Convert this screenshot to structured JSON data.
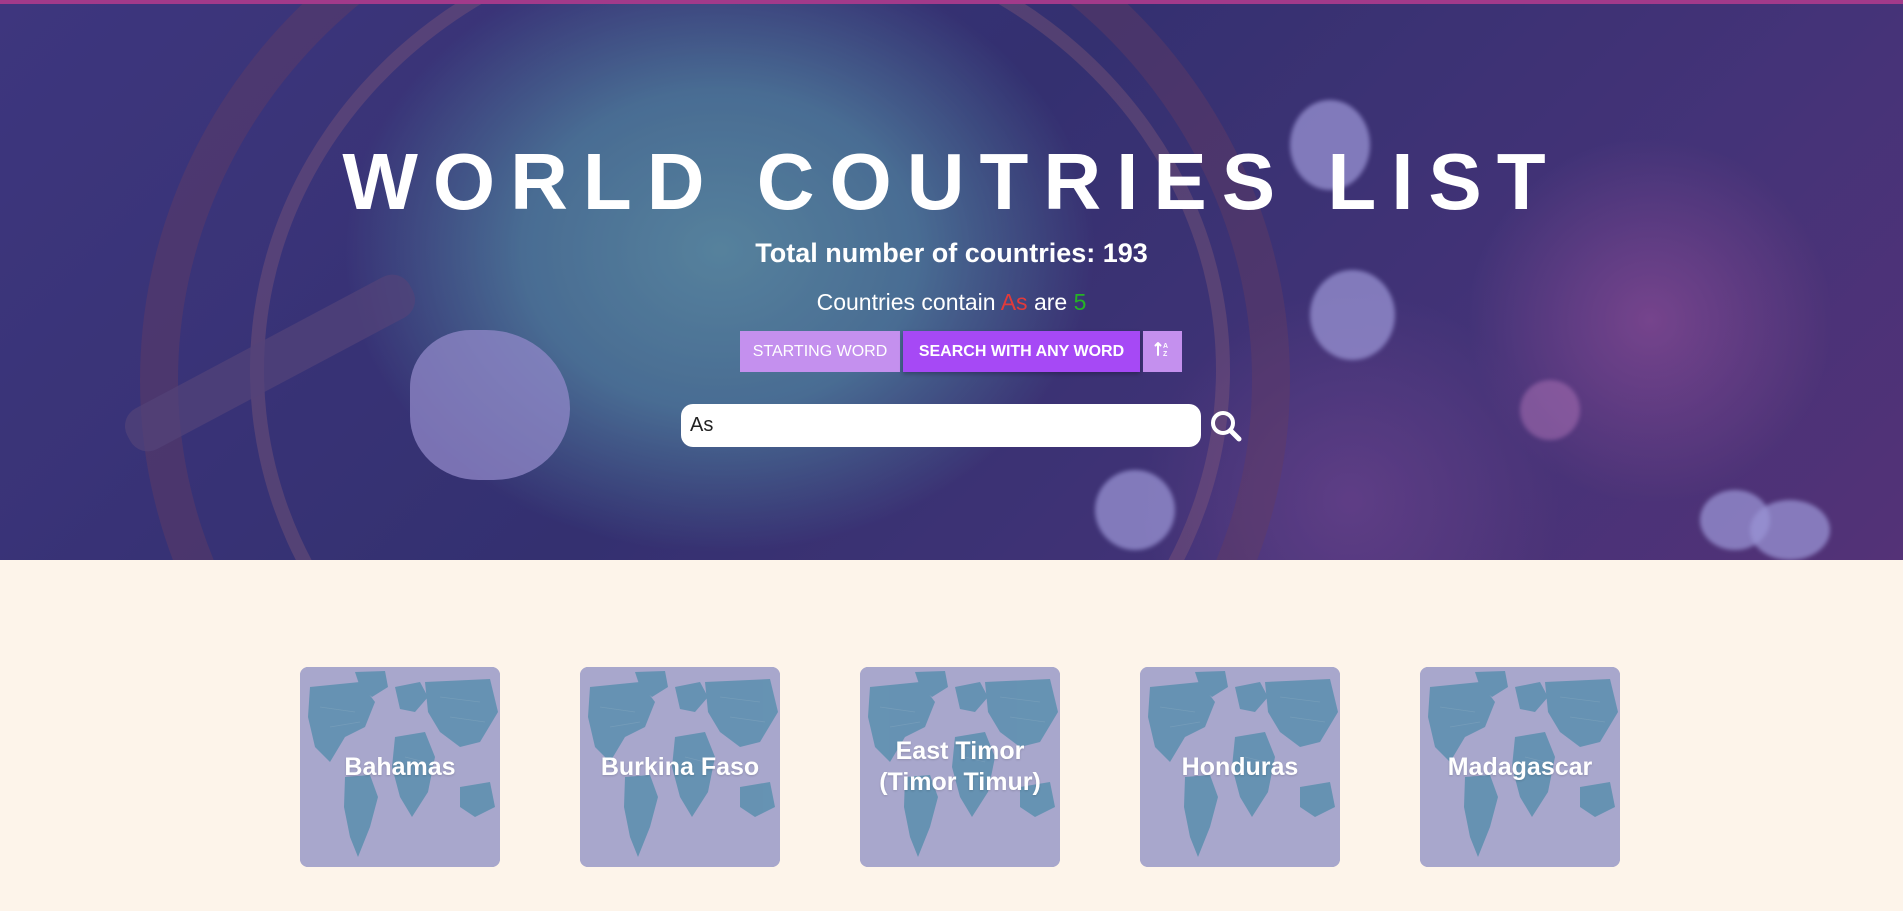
{
  "hero": {
    "title": "WORLD COUTRIES LIST",
    "total_label": "Total number of countries: 193",
    "contain_prefix": "Countries contain ",
    "search_word": "As",
    "contain_middle": " are ",
    "match_count": "5"
  },
  "buttons": {
    "starting_word": "STARTING WORD",
    "search_any_word": "SEARCH WITH ANY WORD",
    "sort_icon": "sort-alpha-icon"
  },
  "search": {
    "value": "As",
    "icon": "search-icon"
  },
  "countries": [
    {
      "name": "Bahamas"
    },
    {
      "name": "Burkina Faso"
    },
    {
      "name": "East Timor (Timor Timur)"
    },
    {
      "name": "Honduras"
    },
    {
      "name": "Madagascar"
    }
  ],
  "colors": {
    "accent_purple": "#a649f5",
    "light_purple": "#c490ee",
    "search_word_red": "#e23a3a",
    "count_green": "#25b325",
    "card_bg": "#a8a7cc",
    "page_bg": "#fdf4ea"
  }
}
